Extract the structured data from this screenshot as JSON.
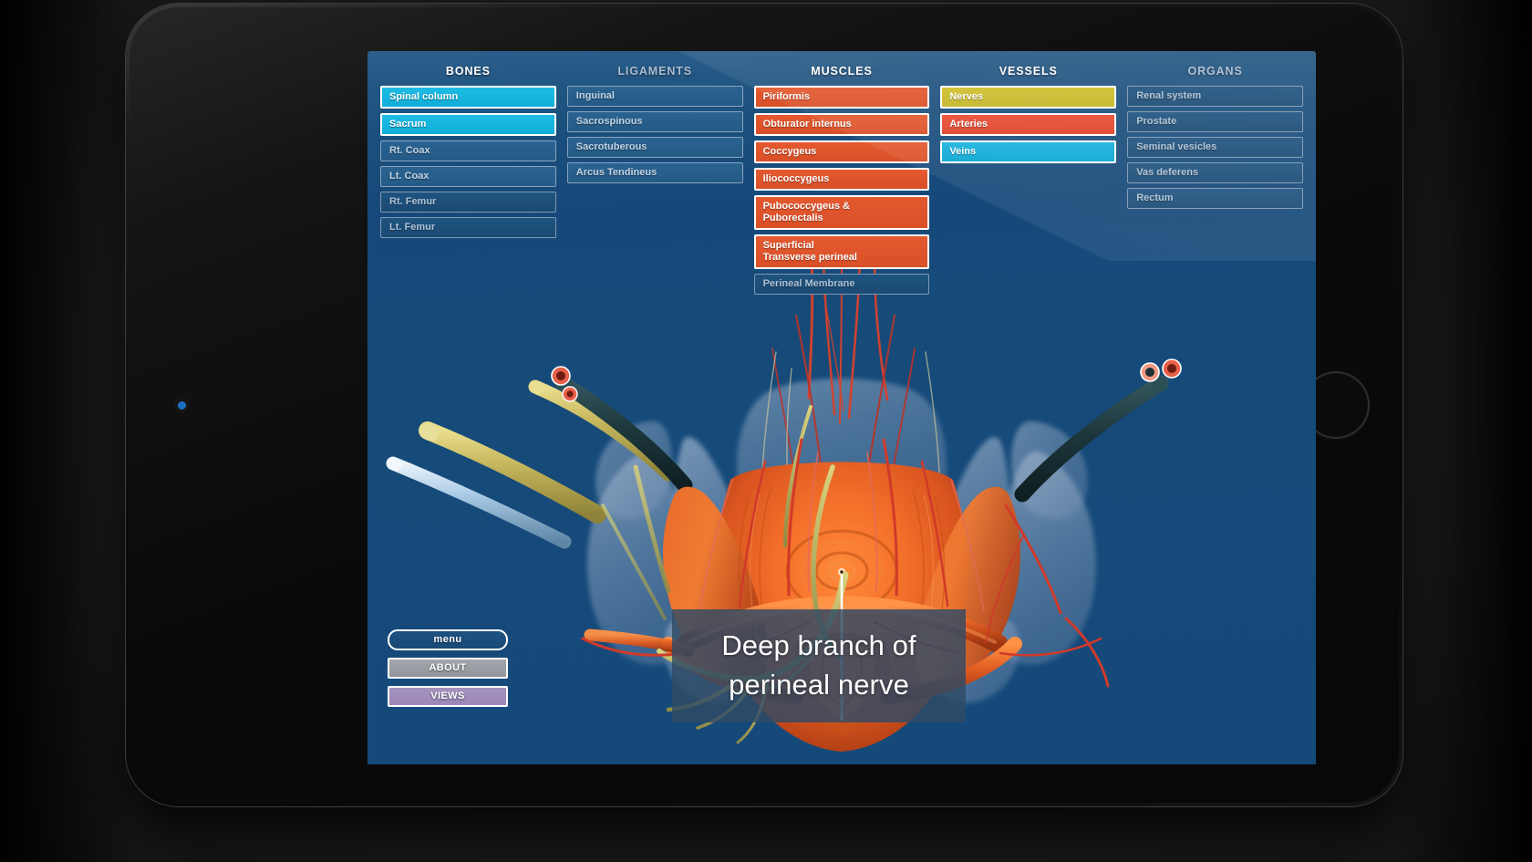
{
  "device": {
    "type": "tablet",
    "camera": "camera-dot",
    "home_button": "home-button"
  },
  "app": {
    "background_color": "#15497a",
    "accent_active_blue": "#16bde5",
    "accent_orange": "#de522b",
    "accent_yellow": "#cbbb2b",
    "accent_red": "#e84a31",
    "accent_cyan": "#0fadd9"
  },
  "columns": [
    {
      "title": "BONES",
      "title_state": "active",
      "items": [
        {
          "label": "Spinal column",
          "state": "on-blue"
        },
        {
          "label": "Sacrum",
          "state": "on-blue"
        },
        {
          "label": "Rt. Coax",
          "state": "off-lite"
        },
        {
          "label": "Lt. Coax",
          "state": "off-lite"
        },
        {
          "label": "Rt. Femur",
          "state": "off"
        },
        {
          "label": "Lt. Femur",
          "state": "off"
        }
      ]
    },
    {
      "title": "LIGAMENTS",
      "title_state": "dim",
      "items": [
        {
          "label": "Inguinal",
          "state": "off-lite"
        },
        {
          "label": "Sacrospinous",
          "state": "off-lite"
        },
        {
          "label": "Sacrotuberous",
          "state": "off-lite"
        },
        {
          "label": "Arcus Tendineus",
          "state": "off-lite"
        }
      ]
    },
    {
      "title": "MUSCLES",
      "title_state": "active",
      "items": [
        {
          "label": "Piriformis",
          "state": "on-orange"
        },
        {
          "label": "Obturator internus",
          "state": "on-orange"
        },
        {
          "label": "Coccygeus",
          "state": "on-orange"
        },
        {
          "label": "Iliococcygeus",
          "state": "on-orange"
        },
        {
          "label": "Pubococcygeus &\nPuborectalis",
          "state": "on-orange",
          "lines": 2
        },
        {
          "label": "Superficial\nTransverse perineal",
          "state": "on-orange",
          "lines": 2
        },
        {
          "label": "Perineal Membrane",
          "state": "off"
        }
      ]
    },
    {
      "title": "VESSELS",
      "title_state": "active",
      "items": [
        {
          "label": "Nerves",
          "state": "on-yellow"
        },
        {
          "label": "Arteries",
          "state": "on-red"
        },
        {
          "label": "Veins",
          "state": "on-cyan"
        }
      ]
    },
    {
      "title": "ORGANS",
      "title_state": "dim",
      "items": [
        {
          "label": "Renal system",
          "state": "off"
        },
        {
          "label": "Prostate",
          "state": "off"
        },
        {
          "label": "Seminal vesicles",
          "state": "off"
        },
        {
          "label": "Vas deferens",
          "state": "off"
        },
        {
          "label": "Rectum",
          "state": "off"
        }
      ]
    }
  ],
  "side_buttons": [
    {
      "label": "menu",
      "style": "menu"
    },
    {
      "label": "ABOUT",
      "style": "about"
    },
    {
      "label": "VIEWS",
      "style": "views"
    }
  ],
  "caption": {
    "line1": "Deep branch of",
    "line2": "perineal nerve"
  },
  "viewport": {
    "content": "3d-pelvic-anatomy-render"
  }
}
